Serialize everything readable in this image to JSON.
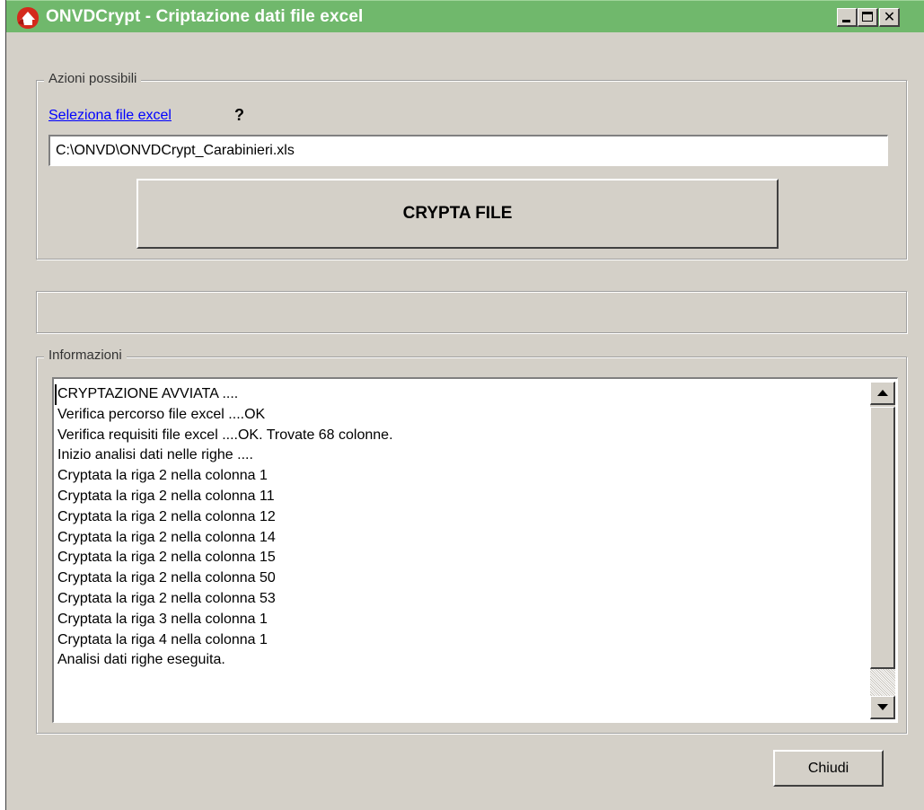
{
  "window": {
    "title": "ONVDCrypt - Criptazione dati file excel",
    "title_bar_color": "#70b86c",
    "app_icon": "red-white-app-icon",
    "caption_buttons": {
      "minimize": "minimize-icon",
      "maximize": "maximize-icon",
      "close": "close-icon"
    }
  },
  "actions_group": {
    "legend": "Azioni possibili",
    "select_link": "Seleziona file excel",
    "help_mark": "?",
    "file_path": "C:\\ONVD\\ONVDCrypt_Carabinieri.xls",
    "crypt_button": "CRYPTA FILE"
  },
  "progress": {
    "value": 0
  },
  "info_group": {
    "legend": "Informazioni",
    "log": [
      "CRYPTAZIONE AVVIATA ....",
      "Verifica percorso file excel ....OK",
      "Verifica requisiti file excel ....OK. Trovate 68 colonne.",
      "Inizio analisi dati nelle righe ....",
      "Cryptata la riga 2 nella colonna 1",
      "Cryptata la riga 2 nella colonna 11",
      "Cryptata la riga 2 nella colonna 12",
      "Cryptata la riga 2 nella colonna 14",
      "Cryptata la riga 2 nella colonna 15",
      "Cryptata la riga 2 nella colonna 50",
      "Cryptata la riga 2 nella colonna 53",
      "Cryptata la riga 3 nella colonna 1",
      "Cryptata la riga 4 nella colonna 1",
      "Analisi dati righe eseguita."
    ]
  },
  "footer": {
    "close_button": "Chiudi"
  }
}
